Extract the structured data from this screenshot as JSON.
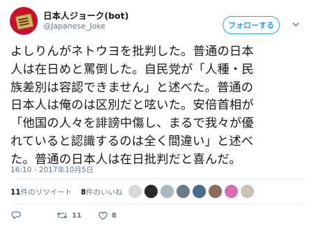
{
  "account": {
    "display_name": "日本人ジョーク(bot)",
    "handle": "@Japanese_Joke",
    "avatar_icon": "hanafuda-card-avatar"
  },
  "follow_button": {
    "label": "フォローする"
  },
  "menu": {
    "icon": "chevron-down-icon"
  },
  "tweet": {
    "lines": [
      "よしりんがネトウヨを批判した。普通の日本",
      "人は在日めと罵倒した。自民党が「人種・民",
      "族差別は容認できません」と述べた。普通の",
      "日本人は俺のは区別だと呟いた。安倍首相が",
      "「他国の人々を誹謗中傷し、まるで我々が優",
      "れていると認識するのは全く間違い」と述べ",
      "た。普通の日本人は在日批判だと喜んだ。"
    ]
  },
  "timestamp": "16:10 - 2017年10月5日",
  "stats": {
    "retweet_count": "11",
    "retweet_label": "件のリツイート",
    "like_count": "8",
    "like_label": "件のいいね"
  },
  "actions": {
    "reply_icon": "reply-icon",
    "retweet_icon": "retweet-icon",
    "retweet_count": "11",
    "like_icon": "heart-icon",
    "like_count": "8"
  },
  "colors": {
    "accent": "#1da1f2",
    "text": "#14171a",
    "muted": "#657786",
    "divider": "#e6ecf0"
  }
}
